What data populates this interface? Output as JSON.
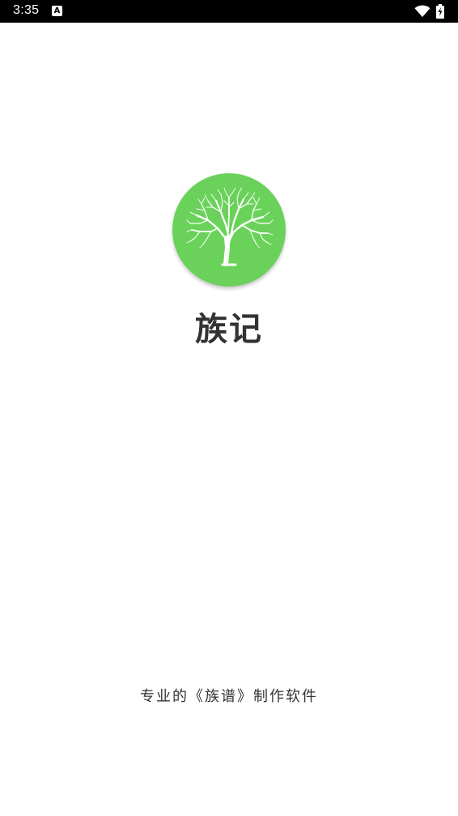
{
  "status_bar": {
    "time": "3:35",
    "notification_icon": "text-a-icon",
    "notification_glyph": "A",
    "wifi_icon": "wifi-icon",
    "battery_icon": "battery-charging-icon"
  },
  "splash": {
    "logo_icon": "tree-icon",
    "logo_color": "#6ad25a",
    "app_name": "族记",
    "slogan": "专业的《族谱》制作软件"
  }
}
